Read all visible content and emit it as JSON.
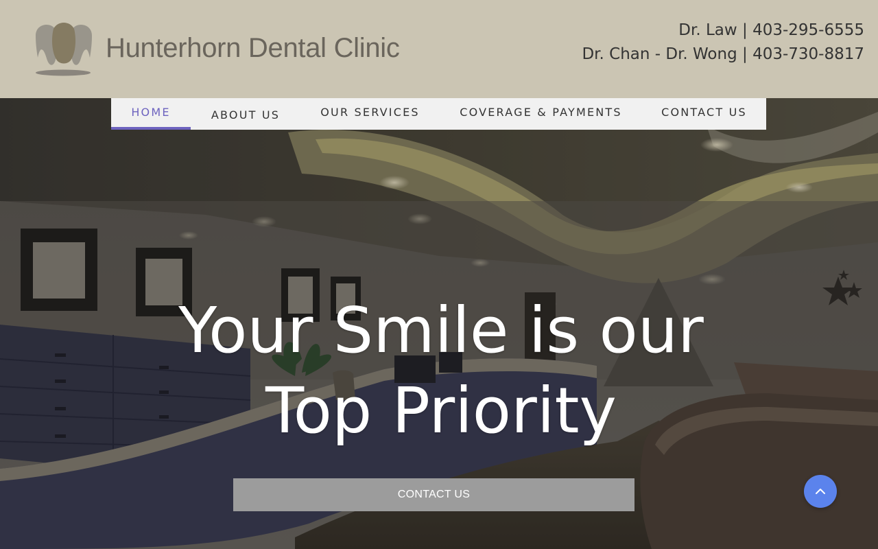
{
  "brand": {
    "name": "Hunterhorn Dental Clinic",
    "logo_icon": "tooth-logo-icon",
    "logo_text_color": "#6a655c"
  },
  "contacts": {
    "line1_name": "Dr. Law",
    "line1_sep": " | ",
    "line1_phone": "403-295-6555",
    "line2_name": "Dr. Chan - Dr. Wong",
    "line2_sep": " | ",
    "line2_phone": "403-730-8817"
  },
  "nav": {
    "home": "HOME",
    "about": "ABOUT US",
    "services": "OUR SERVICES",
    "coverage": "COVERAGE & PAYMENTS",
    "contact": "CONTACT US",
    "active": "home",
    "active_color": "#6d63bf"
  },
  "hero": {
    "title_line1": "Your Smile is our",
    "title_line2": "Top Priority",
    "button_label": "CONTACT US",
    "background": "dental clinic reception interior photo"
  },
  "scroll_top": {
    "icon": "chevron-up-icon",
    "color": "#5b83ec"
  },
  "colors": {
    "header_bg": "#cbc5b3",
    "nav_bg": "#f1f1f1",
    "button_bg": "#9c9c9c"
  }
}
